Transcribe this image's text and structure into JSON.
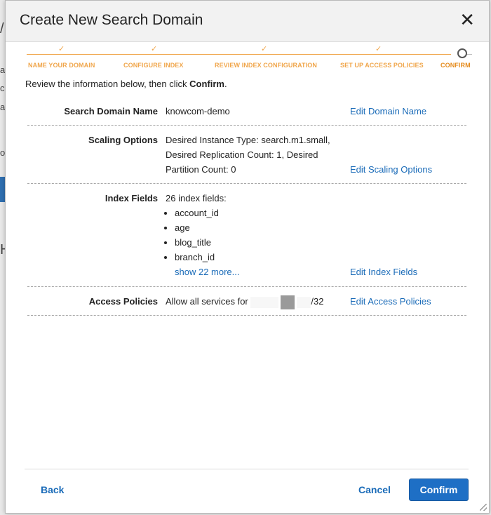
{
  "dialog": {
    "title": "Create New Search Domain",
    "close_symbol": "✕"
  },
  "wizard": {
    "steps": [
      {
        "label": "NAME YOUR DOMAIN",
        "state": "done"
      },
      {
        "label": "CONFIGURE INDEX",
        "state": "done"
      },
      {
        "label": "REVIEW INDEX CONFIGURATION",
        "state": "done"
      },
      {
        "label": "SET UP ACCESS POLICIES",
        "state": "done"
      },
      {
        "label": "CONFIRM",
        "state": "active"
      }
    ],
    "check_symbol": "✓",
    "accent_color": "#f0a64b"
  },
  "intro": {
    "text": "Review the information below, then click ",
    "bold": "Confirm",
    "end": "."
  },
  "review": {
    "domain_name": {
      "label": "Search Domain Name",
      "value": "knowcom-demo",
      "edit": "Edit Domain Name"
    },
    "scaling": {
      "label": "Scaling Options",
      "line1": "Desired Instance Type: search.m1.small,",
      "line2": "Desired Replication Count: 1, Desired",
      "line3": "Partition Count: 0",
      "edit": "Edit Scaling Options"
    },
    "index_fields": {
      "label": "Index Fields",
      "summary": "26 index fields:",
      "fields": [
        "account_id",
        "age",
        "blog_title",
        "branch_id"
      ],
      "more": "show 22 more...",
      "edit": "Edit Index Fields"
    },
    "access": {
      "label": "Access Policies",
      "value_prefix": "Allow all services for",
      "value_suffix": "/32",
      "edit": "Edit Access Policies"
    }
  },
  "footer": {
    "back": "Back",
    "cancel": "Cancel",
    "confirm": "Confirm"
  },
  "background_fragments": [
    "/",
    "a",
    "c",
    "a",
    "o",
    "H"
  ]
}
